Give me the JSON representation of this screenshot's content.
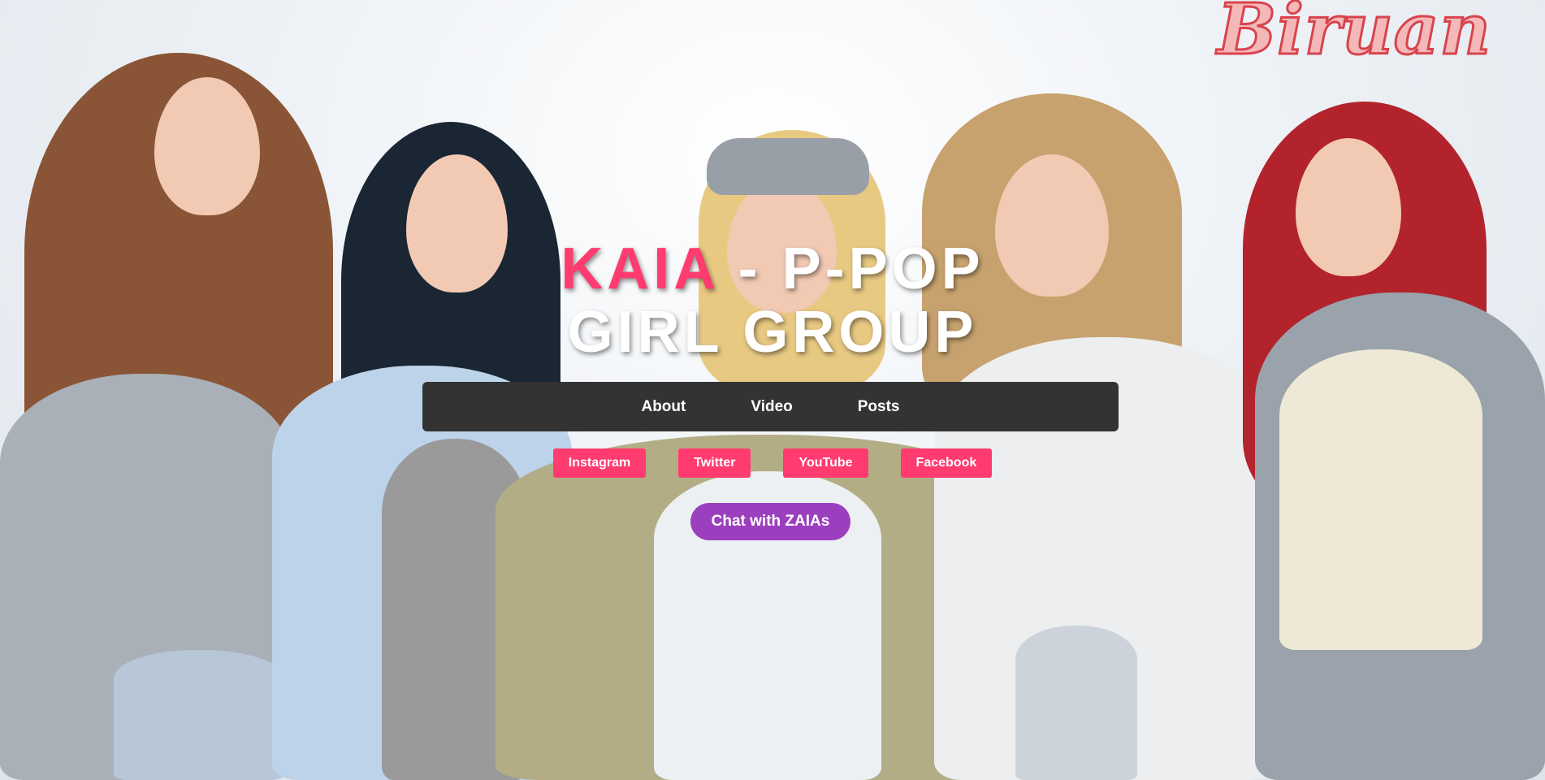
{
  "brand": {
    "logo_text": "Biruan"
  },
  "hero": {
    "title_accent": "KAIA",
    "title_rest": " - P-POP GIRL GROUP",
    "accent_color": "#ff3b6f"
  },
  "nav": {
    "items": [
      {
        "label": "About"
      },
      {
        "label": "Video"
      },
      {
        "label": "Posts"
      }
    ]
  },
  "social": {
    "links": [
      {
        "label": "Instagram"
      },
      {
        "label": "Twitter"
      },
      {
        "label": "YouTube"
      },
      {
        "label": "Facebook"
      }
    ]
  },
  "chat": {
    "label": "Chat with ZAIAs",
    "color": "#9b3fbe"
  }
}
